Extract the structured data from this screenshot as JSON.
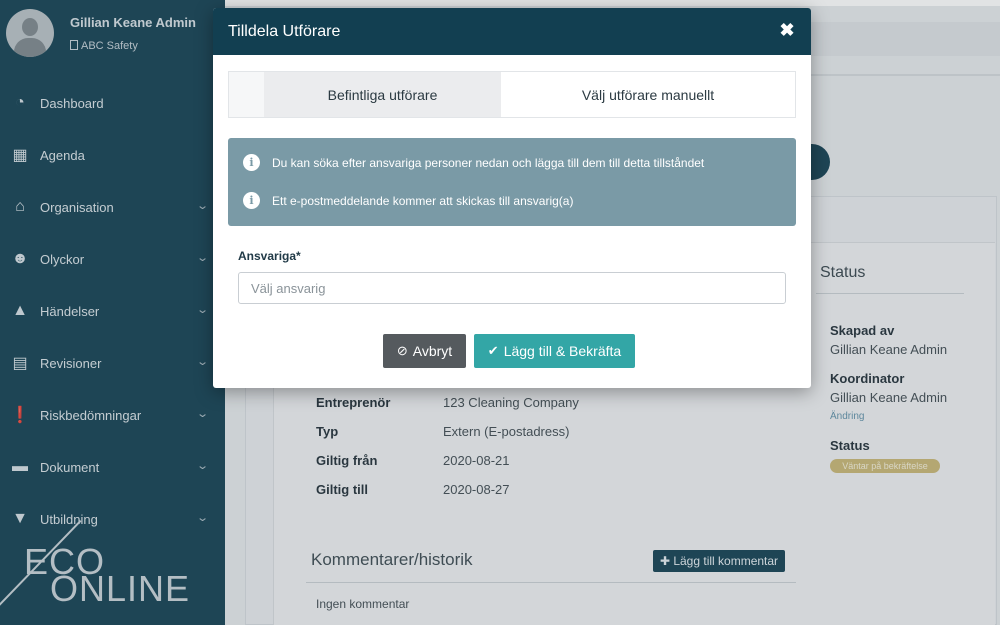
{
  "user": {
    "name": "Gillian Keane Admin",
    "org": "ABC Safety"
  },
  "nav": {
    "items": [
      {
        "label": "Dashboard",
        "icon": "dashboard-icon",
        "glyph": "◔",
        "chevron": false
      },
      {
        "label": "Agenda",
        "icon": "calendar-icon",
        "glyph": "▦",
        "chevron": false
      },
      {
        "label": "Organisation",
        "icon": "home-icon",
        "glyph": "⌂",
        "chevron": true
      },
      {
        "label": "Olyckor",
        "icon": "injured-person-icon",
        "glyph": "☻",
        "chevron": true
      },
      {
        "label": "Händelser",
        "icon": "warning-icon",
        "glyph": "▲",
        "chevron": true
      },
      {
        "label": "Revisioner",
        "icon": "table-icon",
        "glyph": "▤",
        "chevron": true
      },
      {
        "label": "Riskbedömningar",
        "icon": "exclamation-circle-icon",
        "glyph": "❗",
        "chevron": true
      },
      {
        "label": "Dokument",
        "icon": "folder-icon",
        "glyph": "▬",
        "chevron": true
      },
      {
        "label": "Utbildning",
        "icon": "graduation-cap-icon",
        "glyph": "▼",
        "chevron": true
      }
    ]
  },
  "logo": {
    "line1": "ECO",
    "line2": "ONLINE"
  },
  "details": {
    "rows": [
      {
        "label": "Entreprenör",
        "value": "123 Cleaning Company"
      },
      {
        "label": "Typ",
        "value": "Extern (E-postadress)"
      },
      {
        "label": "Giltig från",
        "value": "2020-08-21"
      },
      {
        "label": "Giltig till",
        "value": "2020-08-27"
      }
    ]
  },
  "status_panel": {
    "title": "Status",
    "created_by_label": "Skapad av",
    "created_by": "Gillian Keane Admin",
    "coordinator_label": "Koordinator",
    "coordinator": "Gillian Keane Admin",
    "change_link": "Ändring",
    "status_label": "Status",
    "status_badge": "Väntar på bekräftelse"
  },
  "comments": {
    "title": "Kommentarer/historik",
    "add_button": "Lägg till kommentar",
    "empty": "Ingen kommentar"
  },
  "modal": {
    "title": "Tilldela Utförare",
    "close_glyph": "✖",
    "tabs": [
      {
        "label": "Befintliga utförare",
        "active": true
      },
      {
        "label": "Välj utförare manuellt",
        "active": false
      }
    ],
    "info": [
      "Du kan söka efter ansvariga personer nedan och lägga till dem till detta tillståndet",
      "Ett e-postmeddelande kommer att skickas till ansvarig(a)"
    ],
    "field_label": "Ansvariga*",
    "field_placeholder": "Välj ansvarig",
    "cancel_label": "Avbryt",
    "confirm_label": "Lägg till & Bekräfta"
  }
}
